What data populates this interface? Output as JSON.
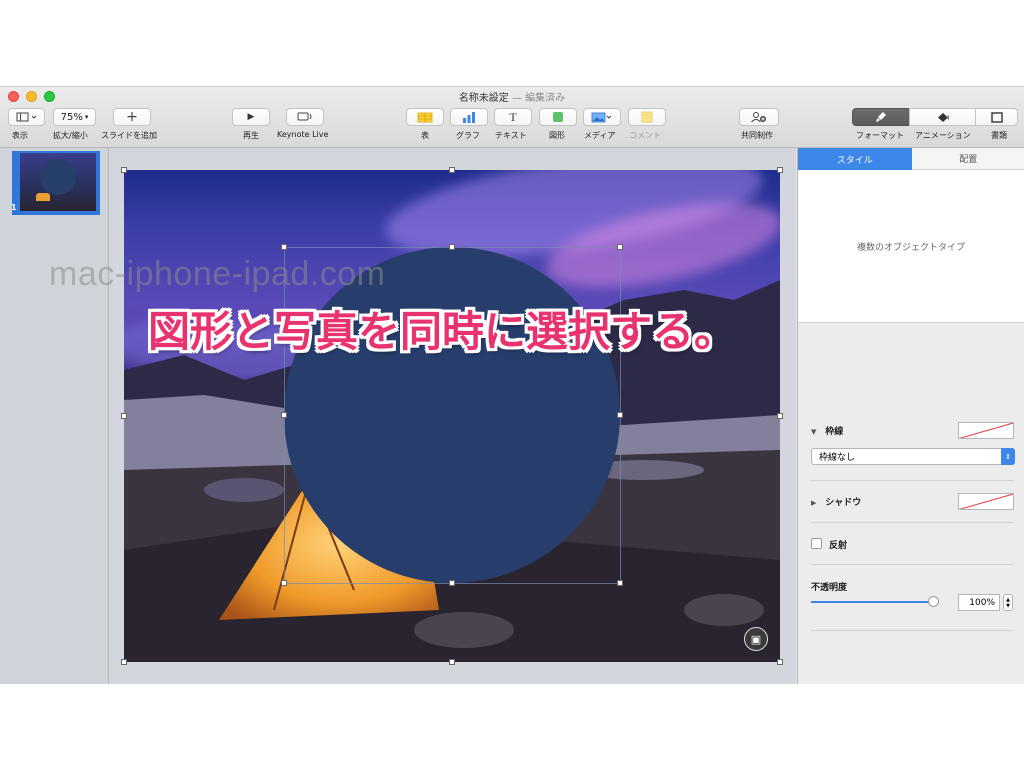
{
  "window": {
    "title": "名称未設定",
    "subtitle": "— 編集済み"
  },
  "toolbar": {
    "view_label": "表示",
    "zoom_value": "75%",
    "zoom_label": "拡大/縮小",
    "add_slide_label": "スライドを追加",
    "play_label": "再生",
    "keynote_live_label": "Keynote Live",
    "table_label": "表",
    "chart_label": "グラフ",
    "text_label": "テキスト",
    "shape_label": "図形",
    "media_label": "メディア",
    "comment_label": "コメント",
    "collaborate_label": "共同制作",
    "format_label": "フォーマット",
    "animate_label": "アニメーション",
    "document_label": "書類"
  },
  "navigator": {
    "slides": [
      {
        "number": "1"
      }
    ]
  },
  "overlay": {
    "watermark": "mac-iphone-ipad.com",
    "headline": "図形と写真を同時に選択する。"
  },
  "inspector": {
    "tabs": [
      "スタイル",
      "配置"
    ],
    "style_message": "複数のオブジェクトタイプ",
    "border_label": "枠線",
    "border_style": "枠線なし",
    "shadow_label": "シャドウ",
    "reflection_label": "反射",
    "opacity_label": "不透明度",
    "opacity_value": "100%",
    "opacity_fraction": 1.0
  },
  "colors": {
    "accent": "#3d87e8",
    "circle_fill": "#273e6c",
    "headline_pink": "#e8336f"
  }
}
